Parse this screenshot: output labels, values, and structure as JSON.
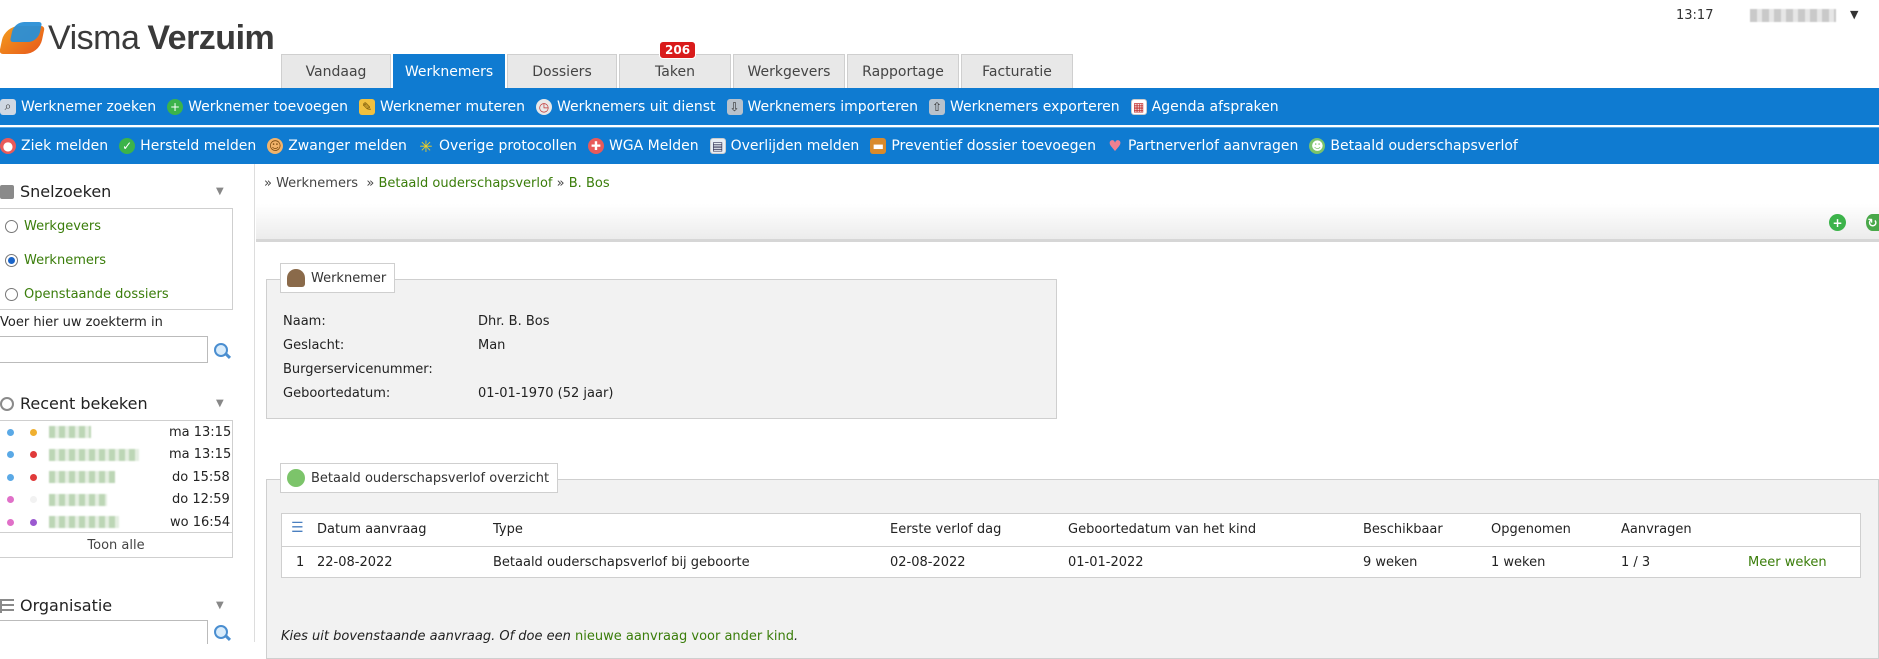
{
  "app": {
    "brand_light": "Visma",
    "brand_bold": "Verzuim"
  },
  "header": {
    "time": "13:17"
  },
  "tabs": [
    {
      "label": "Vandaag",
      "active": false
    },
    {
      "label": "Werknemers",
      "active": true
    },
    {
      "label": "Dossiers",
      "active": false
    },
    {
      "label": "Taken",
      "active": false,
      "badge": "206"
    },
    {
      "label": "Werkgevers",
      "active": false
    },
    {
      "label": "Rapportage",
      "active": false
    },
    {
      "label": "Facturatie",
      "active": false
    }
  ],
  "toolbar1": [
    {
      "label": "Werknemer zoeken",
      "icon": "binoculars-icon"
    },
    {
      "label": "Werknemer toevoegen",
      "icon": "add-circle-icon"
    },
    {
      "label": "Werknemer muteren",
      "icon": "pencil-icon"
    },
    {
      "label": "Werknemers uit dienst",
      "icon": "clock-exit-icon"
    },
    {
      "label": "Werknemers importeren",
      "icon": "import-icon"
    },
    {
      "label": "Werknemers exporteren",
      "icon": "export-icon"
    },
    {
      "label": "Agenda afspraken",
      "icon": "calendar-icon"
    }
  ],
  "toolbar2": [
    {
      "label": "Ziek melden",
      "icon": "pill-icon"
    },
    {
      "label": "Hersteld melden",
      "icon": "check-circle-icon"
    },
    {
      "label": "Zwanger melden",
      "icon": "pregnant-icon"
    },
    {
      "label": "Overige protocollen",
      "icon": "star-icon"
    },
    {
      "label": "WGA Melden",
      "icon": "medicine-icon"
    },
    {
      "label": "Overlijden melden",
      "icon": "document-icon"
    },
    {
      "label": "Preventief dossier toevoegen",
      "icon": "folder-icon"
    },
    {
      "label": "Partnerverlof aanvragen",
      "icon": "hearts-icon"
    },
    {
      "label": "Betaald ouderschapsverlof",
      "icon": "family-icon"
    }
  ],
  "sidebar": {
    "quicksearch": {
      "title": "Snelzoeken",
      "options": [
        {
          "label": "Werkgevers",
          "checked": false
        },
        {
          "label": "Werknemers",
          "checked": true
        },
        {
          "label": "Openstaande dossiers",
          "checked": false
        }
      ],
      "search_label": "Voer hier uw zoekterm in",
      "search_value": ""
    },
    "recent": {
      "title": "Recent bekeken",
      "items": [
        {
          "time": "ma 13:15",
          "dot1": "#5aa9e6",
          "dot2": "#f0b030"
        },
        {
          "time": "ma 13:15",
          "dot1": "#5aa9e6",
          "dot2": "#e03a3a"
        },
        {
          "time": "do 15:58",
          "dot1": "#5aa9e6",
          "dot2": "#e03a3a"
        },
        {
          "time": "do 12:59",
          "dot1": "#e070c8",
          "dot2": "#f2f2f2"
        },
        {
          "time": "wo 16:54",
          "dot1": "#e070c8",
          "dot2": "#9b59d0"
        }
      ],
      "show_all": "Toon alle"
    },
    "organisation": {
      "title": "Organisatie"
    }
  },
  "breadcrumb": {
    "root": "» Werknemers",
    "sep1": "»",
    "level2": "Betaald ouderschapsverlof",
    "sep2": "»",
    "level3": "B. Bos"
  },
  "employee": {
    "legend": "Werknemer",
    "fields": [
      {
        "label": "Naam:",
        "value": "Dhr. B. Bos"
      },
      {
        "label": "Geslacht:",
        "value": "Man"
      },
      {
        "label": "Burgerservicenummer:",
        "value": ""
      },
      {
        "label": "Geboortedatum:",
        "value": "01-01-1970 (52 jaar)"
      }
    ]
  },
  "overview": {
    "legend": "Betaald ouderschapsverlof overzicht",
    "columns": [
      "Datum aanvraag",
      "Type",
      "Eerste verlof dag",
      "Geboortedatum van het kind",
      "Beschikbaar",
      "Opgenomen",
      "Aanvragen"
    ],
    "rows": [
      {
        "index": "1",
        "datum": "22-08-2022",
        "type": "Betaald ouderschapsverlof bij geboorte",
        "eerste": "02-08-2022",
        "geboortedatum": "01-01-2022",
        "beschikbaar": "9 weken",
        "opgenomen": "1 weken",
        "aanvragen": "1 / 3",
        "action": "Meer weken"
      }
    ],
    "note_text": "Kies uit bovenstaande aanvraag. Of doe een",
    "note_link": "nieuwe aanvraag voor ander kind",
    "note_end": "."
  },
  "colors": {
    "primary": "#0f7bd1",
    "link": "#3a7d0a",
    "badge": "#d91b1b"
  }
}
